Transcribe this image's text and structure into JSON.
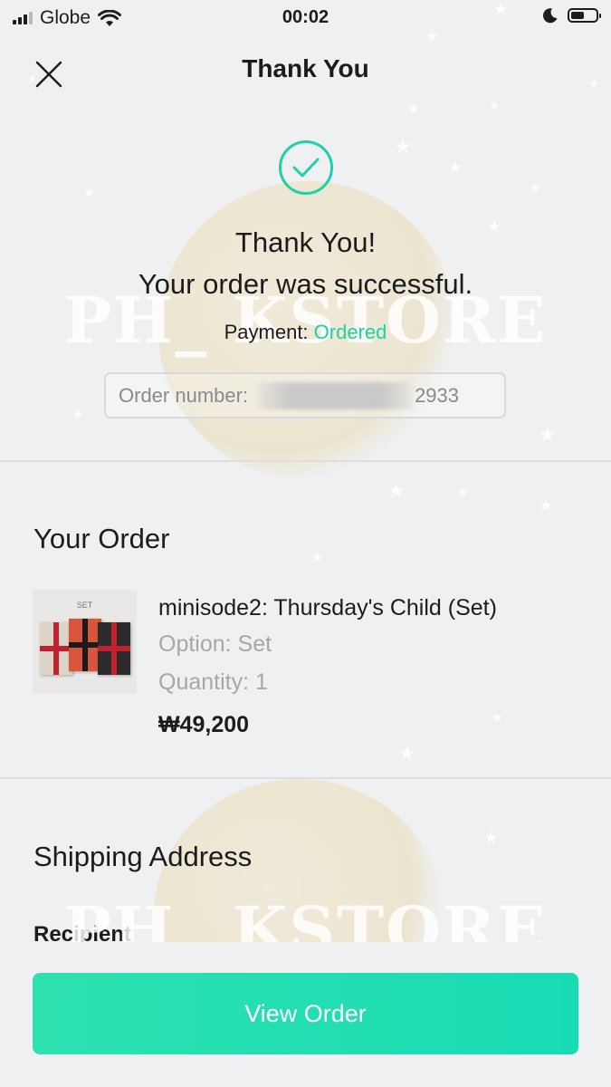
{
  "status_bar": {
    "carrier": "Globe",
    "time": "00:02",
    "battery_level": 0.55
  },
  "nav": {
    "title": "Thank You",
    "close_icon": "close-icon"
  },
  "confirmation": {
    "icon": "check-circle-icon",
    "line1": "Thank You!",
    "line2": "Your order was successful.",
    "payment_label": "Payment:",
    "payment_status": "Ordered",
    "order_number_label": "Order number:",
    "order_number_suffix": "2933"
  },
  "watermark": "PH_ KSTORE",
  "order_section": {
    "title": "Your Order",
    "item": {
      "thumb_label": "SET",
      "name": "minisode2: Thursday's Child (Set)",
      "option": "Option: Set",
      "quantity": "Quantity: 1",
      "price": "₩49,200"
    }
  },
  "shipping_section": {
    "title": "Shipping Address",
    "recipient_label": "Recipient"
  },
  "footer": {
    "button_label": "View Order"
  },
  "colors": {
    "accent": "#1fd1a6",
    "button": "#22ddb2",
    "background": "#eff0f2"
  }
}
